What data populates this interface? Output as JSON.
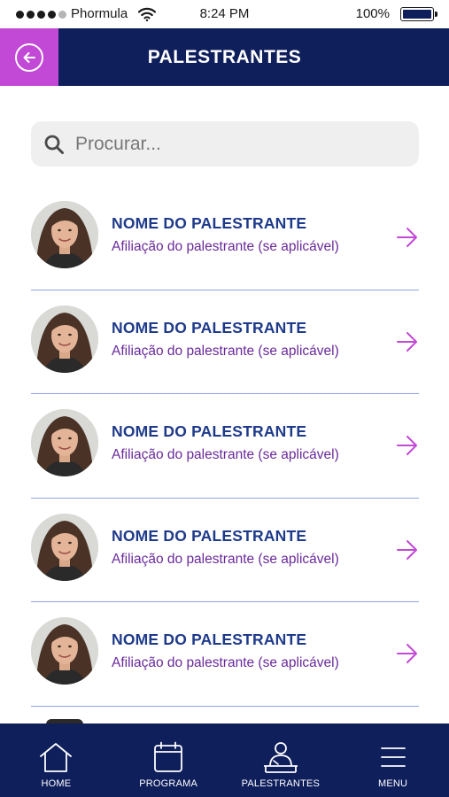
{
  "status_bar": {
    "carrier": "Phormula",
    "time": "8:24 PM",
    "battery": "100%"
  },
  "header": {
    "title": "PALESTRANTES",
    "back_icon": "back-arrow-circle-icon"
  },
  "search": {
    "placeholder": "Procurar...",
    "value": ""
  },
  "speakers": [
    {
      "name": "NOME DO PALESTRANTE",
      "affiliation": "Afiliação do palestrante (se aplicável)"
    },
    {
      "name": "NOME DO PALESTRANTE",
      "affiliation": "Afiliação do palestrante (se aplicável)"
    },
    {
      "name": "NOME DO PALESTRANTE",
      "affiliation": "Afiliação do palestrante (se aplicável)"
    },
    {
      "name": "NOME DO PALESTRANTE",
      "affiliation": "Afiliação do palestrante (se aplicável)"
    },
    {
      "name": "NOME DO PALESTRANTE",
      "affiliation": "Afiliação do palestrante (se aplicável)"
    }
  ],
  "bottom_nav": [
    {
      "label": "HOME",
      "icon": "home-icon"
    },
    {
      "label": "PROGRAMA",
      "icon": "calendar-icon"
    },
    {
      "label": "PALESTRANTES",
      "icon": "speaker-podium-icon"
    },
    {
      "label": "MENU",
      "icon": "hamburger-menu-icon"
    }
  ],
  "colors": {
    "navy": "#0f1f5c",
    "accent_purple": "#c248d6",
    "name_blue": "#1e3a8a",
    "affiliation_purple": "#6a2a9a",
    "divider": "#8ea5e3"
  }
}
